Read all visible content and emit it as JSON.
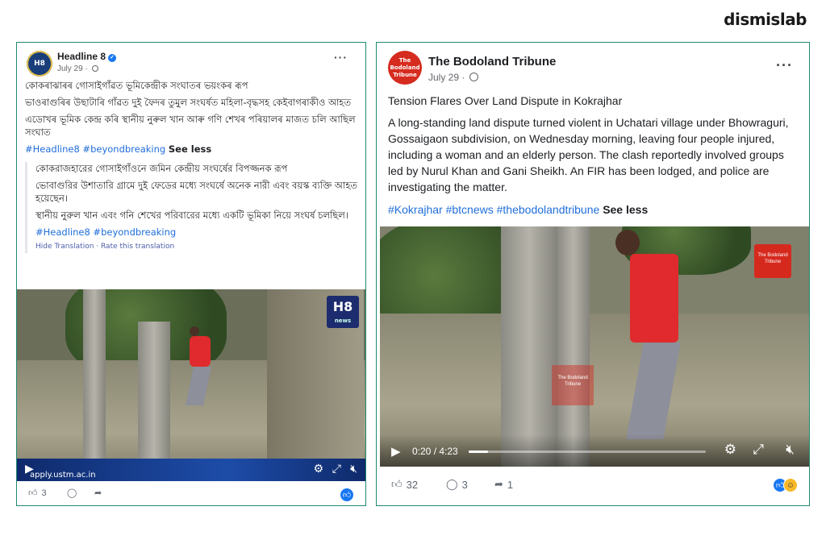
{
  "brand": "dismislab",
  "post1": {
    "page_name": "Headline 8",
    "date": "July 29 ·",
    "avatar_text": "H8",
    "text_lines": [
      "কোকৰাঝাৰৰ গোসাইগাঁৱত ভূমিকেন্দ্ৰীক সংঘাতৰ ভয়ংকৰ ৰূপ",
      "ভাওৰাগুৰিৰ উছাটাৰি গাঁৱত দুই ফৈদৰ তুমুল সংঘৰ্ষত মহিলা-বৃদ্ধসহ কেইবাগৰাকীও আহত",
      "এডোখৰ ভূমিক কেন্দ্ৰ কৰি স্থানীয় নুৰুল খান আৰু গণি শেখৰ পৰিয়ালৰ মাজত চলি আছিল সংঘাত"
    ],
    "hashtags": "#Headline8 #beyondbreaking",
    "see_less": "See less",
    "translation_lines": [
      "কোকরাজহারের গোসাইগাঁওনে জমিন কেন্দ্রীয় সংঘর্ষের বিপজ্জনক রূপ",
      "ভোবাগুরির উশাতারি গ্রামে দুই ফেডের মধ্যে সংঘর্ষে অনেক নারী এবং বয়স্ক ব্যক্তি আহত হয়েছেন।",
      "স্থানীয় নুরুল খান এবং গনি শেখের পরিবারের মধ্যে একটি ভূমিকা নিয়ে সংঘর্ষ চলছিল।"
    ],
    "translation_hashtags": "#Headline8 #beyondbreaking",
    "hide_translation": "Hide Translation · Rate this translation",
    "video_logo": "H8",
    "video_logo_sub": "news",
    "ad_text": "apply.ustm.ac.in",
    "likes": "3"
  },
  "post2": {
    "page_name": "The Bodoland Tribune",
    "date": "July 29 ·",
    "avatar_text": "The Bodoland Tribune",
    "title": "Tension Flares Over Land Dispute in Kokrajhar",
    "body": "A long-standing land dispute turned violent in Uchatari village under Bhowraguri, Gossaigaon subdivision, on Wednesday morning, leaving four people injured, including a woman and an elderly person. The clash reportedly involved groups led by Nurul Khan and Gani Sheikh. An FIR has been lodged, and police are investigating the matter.",
    "hashtags": "#Kokrajhar #btcnews #thebodolandtribune",
    "see_less": "See less",
    "video_time": "0:20 / 4:23",
    "video_progress": 0.08,
    "watermark": "The Bodoland Tribune",
    "likes": "32",
    "comments": "3",
    "shares": "1"
  },
  "colors": {
    "border": "#1f8a70",
    "link": "#216fdb",
    "shirt": "#e02a2e"
  }
}
